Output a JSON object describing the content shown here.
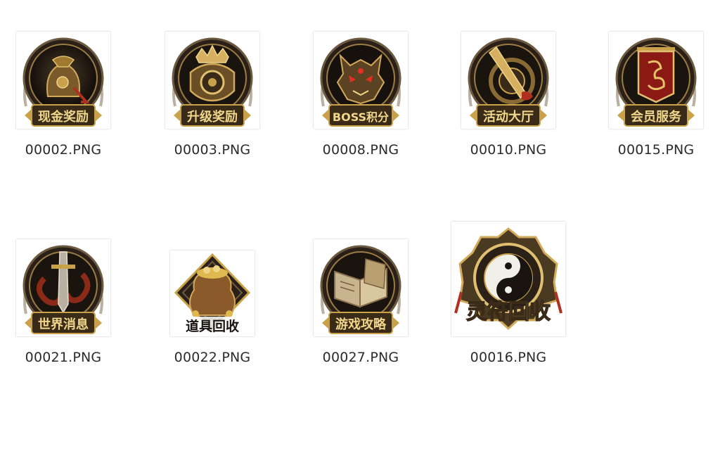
{
  "files": [
    {
      "name": "00002.PNG",
      "caption": "现金奖励",
      "emblem": "money-bag-icon"
    },
    {
      "name": "00003.PNG",
      "caption": "升级奖励",
      "emblem": "treasure-chest-icon"
    },
    {
      "name": "00008.PNG",
      "caption": "BOSS积分",
      "emblem": "demon-mask-icon"
    },
    {
      "name": "00010.PNG",
      "caption": "活动大厅",
      "emblem": "sword-emblem-icon"
    },
    {
      "name": "00015.PNG",
      "caption": "会员服务",
      "emblem": "dragon-banner-icon"
    },
    {
      "name": "00021.PNG",
      "caption": "世界消息",
      "emblem": "sword-ribbon-icon"
    },
    {
      "name": "00022.PNG",
      "caption": "道具回收",
      "emblem": "gold-sack-icon"
    },
    {
      "name": "00027.PNG",
      "caption": "游戏攻略",
      "emblem": "open-book-icon"
    },
    {
      "name": "00016.PNG",
      "caption": "灵符回收",
      "emblem": "yin-yang-icon"
    }
  ],
  "colors": {
    "ring_dark": "#1a1410",
    "gold": "#c9a14a",
    "gold_light": "#f0d68a",
    "label_bg": "#3a2a18",
    "banner_red": "#8b1a14",
    "text": "#2b2b2b"
  }
}
